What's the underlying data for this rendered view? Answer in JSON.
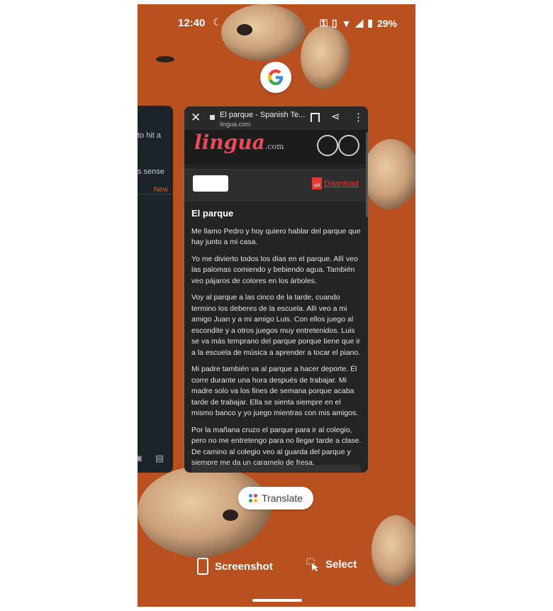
{
  "status_bar": {
    "time": "12:40",
    "battery": "29%"
  },
  "browser_tab": {
    "title": "El parque - Spanish Te...",
    "url": "lingua.com",
    "logo_text": "lingua",
    "logo_suffix": ".com",
    "download_label": "Download",
    "pdf_label": "pdf"
  },
  "article": {
    "heading": "El parque",
    "paragraphs": [
      "Me llamo Pedro y hoy quiero hablar del parque que hay junto a mi casa.",
      "Yo me divierto todos los días en el parque. Allí veo las palomas comiendo y bebiendo agua. También veo pájaros de colores en los árboles.",
      "Voy al parque a las cinco de la tarde, cuando termino los deberes de la escuela. Allí veo a mi amigo Juan y a mi amigo Luis. Con ellos juego al escondite y a otros juegos muy entretenidos. Luis se va más temprano del parque porque tiene que ir a la escuela de música a aprender a tocar el piano.",
      "Mi padre también va al parque a hacer deporte. Él corre durante una hora después de trabajar. Mi madre solo va los fines de semana porque acaba tarde de trabajar. Ella se sienta siempre en el mismo banco y yo juego mientras con mis amigos.",
      "Por la mañana cruzo el parque para ir al colegio, pero no me entretengo para no llegar tarde a clase. De camino al colegio veo al guarda del parque y siempre me da un caramelo de fresa."
    ]
  },
  "left_card": {
    "line1": "to hit a",
    "line2": "s sense",
    "badge": "New"
  },
  "chips": {
    "translate_label": "Translate"
  },
  "actions": {
    "screenshot_label": "Screenshot",
    "select_label": "Select"
  },
  "colors": {
    "wallpaper": "#b9501f",
    "brand_red": "#e84a5c",
    "download_red": "#e53935"
  },
  "icons": [
    "moon-icon",
    "key-icon",
    "vibrate-icon",
    "wifi-icon",
    "signal-icon",
    "battery-icon",
    "google-logo-icon",
    "close-icon",
    "lock-icon",
    "bookmark-icon",
    "share-icon",
    "more-vert-icon",
    "pdf-icon",
    "lens-icon",
    "screenshot-icon",
    "select-icon"
  ]
}
